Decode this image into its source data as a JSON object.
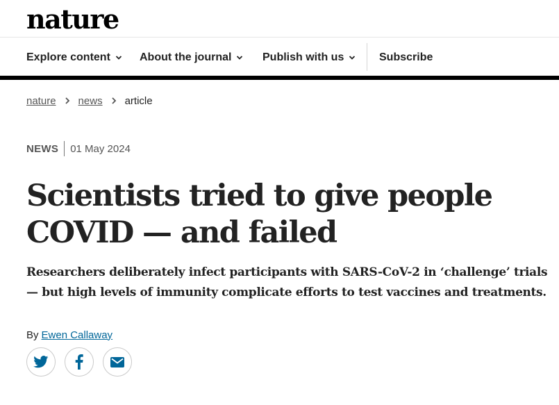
{
  "brand": {
    "logo_text": "nature"
  },
  "nav": {
    "items": [
      {
        "label": "Explore content"
      },
      {
        "label": "About the journal"
      },
      {
        "label": "Publish with us"
      }
    ],
    "subscribe_label": "Subscribe"
  },
  "breadcrumb": {
    "items": [
      "nature",
      "news"
    ],
    "current": "article"
  },
  "article": {
    "type": "NEWS",
    "date": "01 May 2024",
    "title": "Scientists tried to give people COVID — and failed",
    "standfirst": "Researchers deliberately infect participants with SARS-CoV-2 in ‘challenge’ trials — but high levels of immunity complicate efforts to test vaccines and treatments.",
    "byline_prefix": "By",
    "author": "Ewen Callaway"
  },
  "share": {
    "icons": [
      "twitter-icon",
      "facebook-icon",
      "email-icon"
    ],
    "icon_color": "#006699"
  },
  "colors": {
    "text": "#222222",
    "link": "#006699",
    "muted": "#555555",
    "rule": "#000000"
  }
}
